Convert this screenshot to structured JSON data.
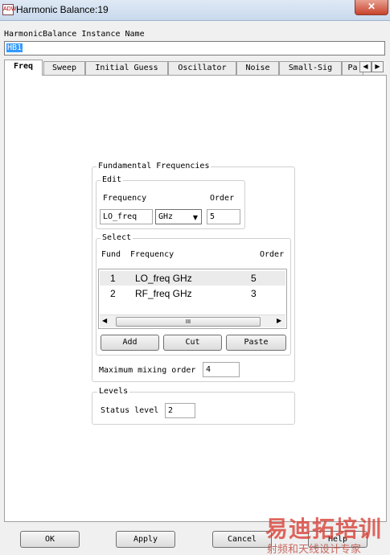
{
  "window": {
    "title": "Harmonic Balance:19",
    "icon": "adw-app-icon",
    "close_label": "✕"
  },
  "instance": {
    "label": "HarmonicBalance Instance Name",
    "value": "HB1"
  },
  "tabs": [
    {
      "label": "Freq",
      "active": true
    },
    {
      "label": "Sweep"
    },
    {
      "label": "Initial Guess"
    },
    {
      "label": "Oscillator"
    },
    {
      "label": "Noise"
    },
    {
      "label": "Small-Sig"
    },
    {
      "label": "Pa"
    }
  ],
  "tab_scroll": {
    "left": "◀",
    "right": "▶"
  },
  "fundamental": {
    "title": "Fundamental Frequencies",
    "edit": {
      "title": "Edit",
      "frequency_label": "Frequency",
      "order_label": "Order",
      "frequency_value": "LO_freq",
      "unit_value": "GHz",
      "order_value": "5"
    },
    "select": {
      "title": "Select",
      "columns": [
        "Fund",
        "Frequency",
        "Order"
      ],
      "rows": [
        {
          "fund": "1",
          "frequency": "LO_freq GHz",
          "order": "5",
          "selected": true
        },
        {
          "fund": "2",
          "frequency": "RF_freq GHz",
          "order": "3"
        }
      ],
      "scroll_thumb": "III",
      "scroll_left": "◀",
      "scroll_right": "▶"
    },
    "buttons": {
      "add": "Add",
      "cut": "Cut",
      "paste": "Paste"
    },
    "max_mixing_label": "Maximum mixing order",
    "max_mixing_value": "4"
  },
  "levels": {
    "title": "Levels",
    "status_label": "Status level",
    "status_value": "2"
  },
  "bottom": {
    "ok": "OK",
    "apply": "Apply",
    "cancel": "Cancel",
    "help": "Help"
  },
  "watermark": {
    "big": "易迪拓培训",
    "small": "射频和天线设计专家"
  }
}
